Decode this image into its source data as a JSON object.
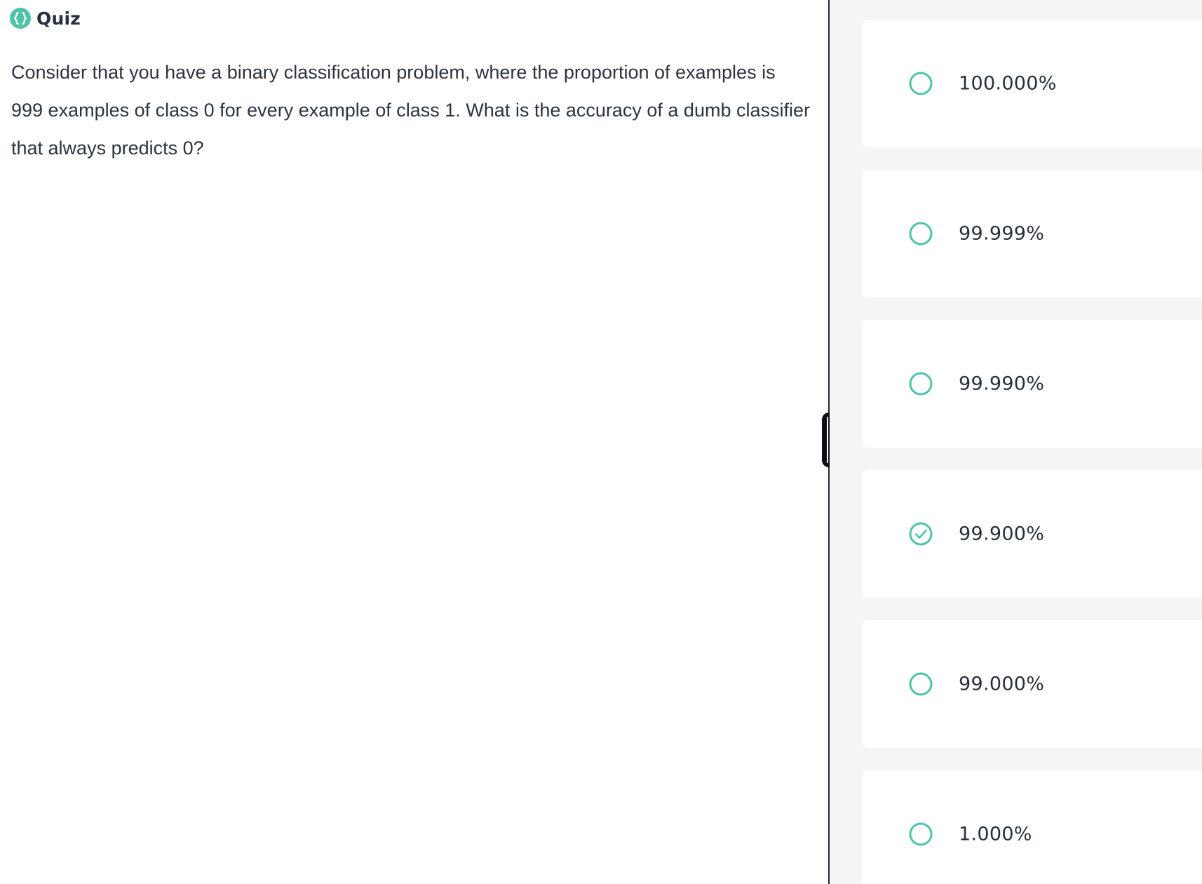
{
  "header": {
    "logo_icon": "curly-braces-icon",
    "title": "Quiz"
  },
  "question": {
    "text": "Consider that you have a binary classification problem, where the proportion of examples is 999 examples of class 0 for every example of class 1. What is the accuracy of a dumb classifier that always predicts 0?"
  },
  "options": [
    {
      "label": "100.000%",
      "selected": false
    },
    {
      "label": "99.999%",
      "selected": false
    },
    {
      "label": "99.990%",
      "selected": false
    },
    {
      "label": "99.900%",
      "selected": true
    },
    {
      "label": "99.000%",
      "selected": false
    },
    {
      "label": "1.000%",
      "selected": false
    }
  ],
  "colors": {
    "accent": "#4fc3a8",
    "text": "#2b3440",
    "divider": "#1f2a37",
    "panel_bg": "#f4f5f7"
  }
}
